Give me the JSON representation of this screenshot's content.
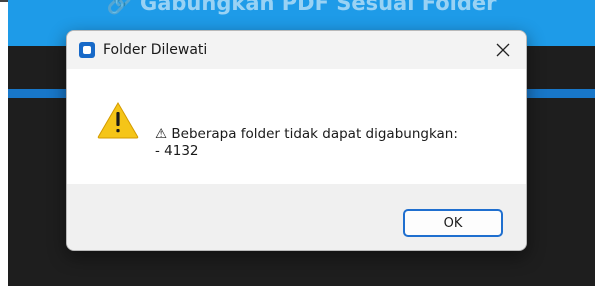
{
  "background_app": {
    "header_title": "🔗 Gabungkan PDF Sesuai Folder",
    "header_color": "#1e9be8",
    "accent_color": "#1877c9",
    "body_color": "#1e1e1e"
  },
  "dialog": {
    "title": "Folder Dilewati",
    "app_icon": "app-window-icon",
    "close_icon": "close-icon",
    "warning_icon": "warning-triangle-icon",
    "message_line1": "⚠ Beberapa folder tidak dapat digabungkan:",
    "message_line2": "- 4132",
    "ok_label": "OK",
    "ok_border_color": "#1f6fcf"
  }
}
